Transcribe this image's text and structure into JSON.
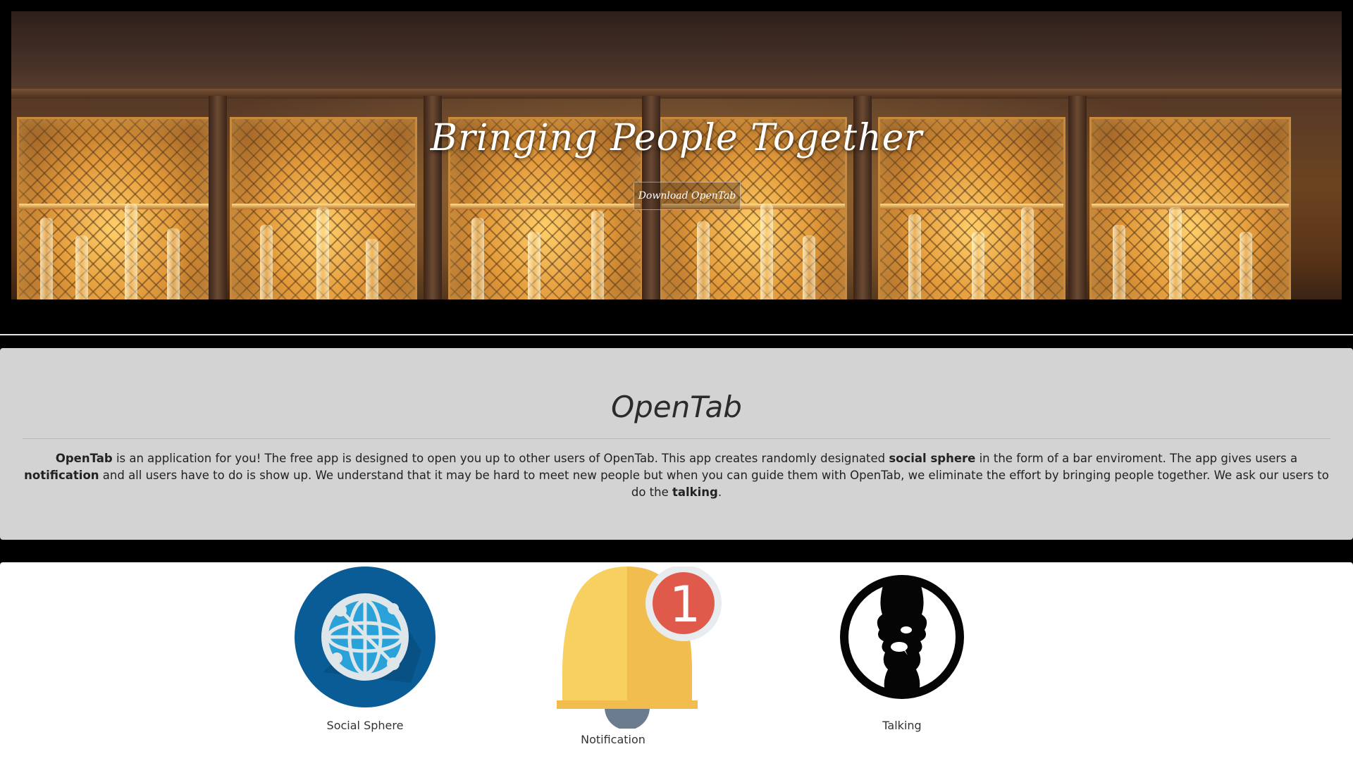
{
  "hero": {
    "title": "Bringing People Together",
    "button_label": "Download OpenTab"
  },
  "about": {
    "heading": "OpenTab",
    "paragraph": {
      "brand": "OpenTab",
      "t1": " is an application for you! The free app is designed to open you up to other users of OpenTab. This app creates randomly designated ",
      "kw1": "social sphere",
      "t2": " in the form of a bar enviroment. The app gives users a ",
      "kw2": "notification",
      "t3": " and all users have to do is show up. We understand that it may be hard to meet new people but when you can guide them with OpenTab, we eliminate the effort by bringing people together. We ask our users to do the ",
      "kw3": "talking",
      "t4": "."
    }
  },
  "features": [
    {
      "label": "Social Sphere",
      "icon": "globe-network-icon"
    },
    {
      "label": "Notification",
      "icon": "bell-icon",
      "badge": "1"
    },
    {
      "label": "Talking",
      "icon": "faces-talking-icon"
    }
  ],
  "colors": {
    "about_bg": "#d3d3d3",
    "globe_blue": "#0a5c96",
    "bell_yellow": "#f7c85a",
    "badge_red": "#e05a4c"
  }
}
